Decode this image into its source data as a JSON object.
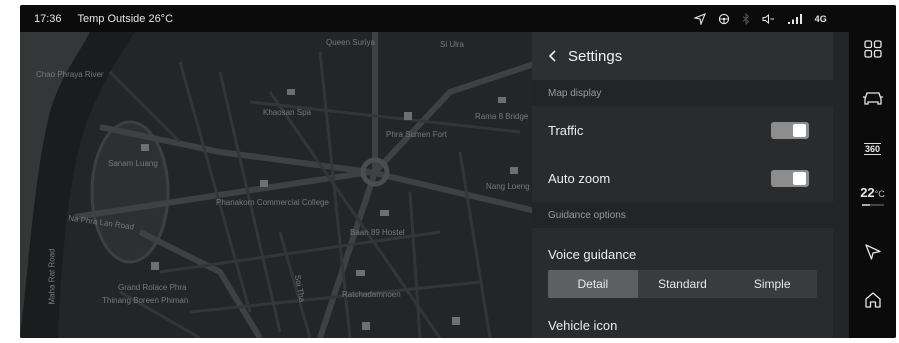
{
  "status_bar": {
    "time": "17:36",
    "temperature_outside": "Temp Outside 26°C",
    "network": "4G",
    "icons": [
      "navigation-arrow-icon",
      "steering-icon",
      "bluetooth-icon",
      "volume-icon",
      "signal-icon"
    ]
  },
  "map": {
    "labels": [
      "Chao Phraya River",
      "Queen Suriya",
      "Si Ulra",
      "Khaosan Spa",
      "Rama 8 Bridge",
      "Phra Sumen Fort",
      "Sanam Luang",
      "Phanakorn Commercial College",
      "Nang Loeng Station",
      "Baan 89 Hostel",
      "Grand Rolace Phra",
      "Thinang Boreen Phiman",
      "Na Phra Lan Road",
      "Maha Rat Road",
      "Soi Tha",
      "Ratchadamnoen"
    ]
  },
  "settings": {
    "title": "Settings",
    "sections": {
      "map_display": "Map display",
      "guidance_options": "Guidance options"
    },
    "traffic": {
      "label": "Traffic",
      "enabled": true
    },
    "auto_zoom": {
      "label": "Auto zoom",
      "enabled": true
    },
    "voice_guidance": {
      "label": "Voice guidance",
      "options": [
        "Detail",
        "Standard",
        "Simple"
      ],
      "selected": "Detail"
    },
    "vehicle_icon_label": "Vehicle icon"
  },
  "right_bar": {
    "items": [
      "apps-grid-icon",
      "car-icon",
      "360-camera-icon",
      "climate",
      "navigation-icon",
      "home-icon"
    ],
    "camera_label": "360",
    "climate_temp": "22",
    "climate_unit": "°C"
  },
  "colors": {
    "map_background": "#232526",
    "panel_background": "#2a2b2d",
    "toggle_on": "#8d8d8d",
    "selected_segment": "#5e5f61"
  }
}
